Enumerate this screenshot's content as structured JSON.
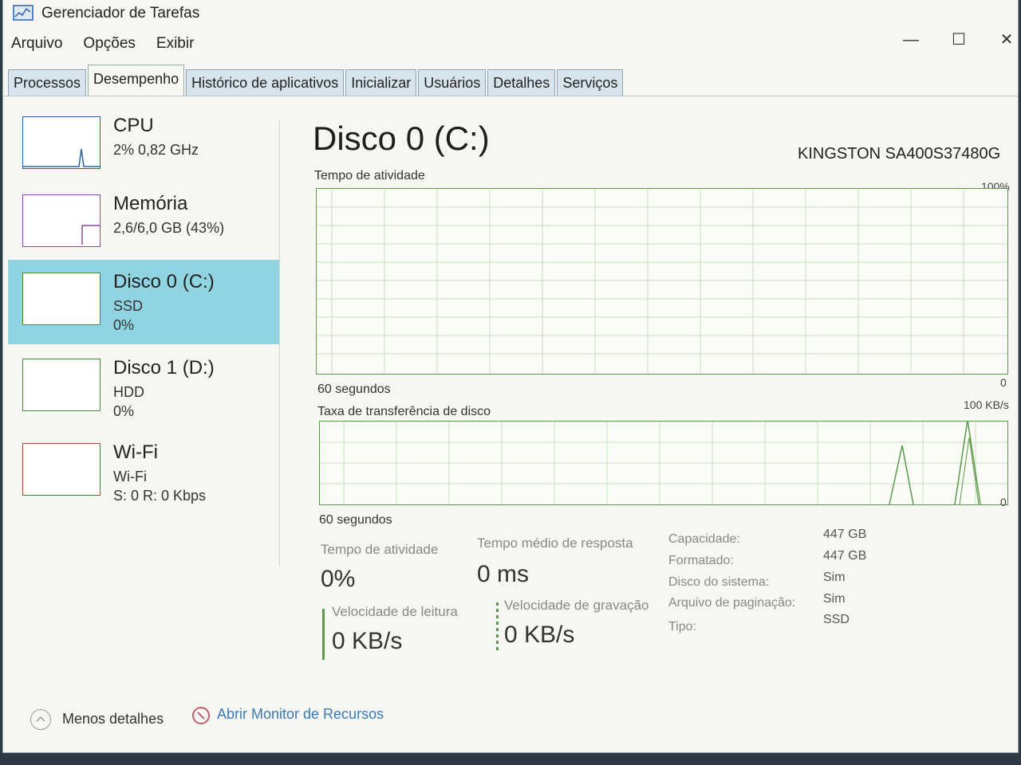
{
  "window": {
    "title": "Gerenciador de Tarefas",
    "controls": {
      "minimize": "—",
      "maximize": "☐",
      "close": "✕"
    }
  },
  "menu": [
    "Arquivo",
    "Opções",
    "Exibir"
  ],
  "tabs": [
    {
      "label": "Processos",
      "active": false
    },
    {
      "label": "Desempenho",
      "active": true
    },
    {
      "label": "Histórico de aplicativos",
      "active": false
    },
    {
      "label": "Inicializar",
      "active": false
    },
    {
      "label": "Usuários",
      "active": false
    },
    {
      "label": "Detalhes",
      "active": false
    },
    {
      "label": "Serviços",
      "active": false
    }
  ],
  "sidebar": {
    "items": [
      {
        "name": "CPU",
        "line1": "2% 0,82 GHz",
        "line2": ""
      },
      {
        "name": "Memória",
        "line1": "2,6/6,0 GB (43%)",
        "line2": ""
      },
      {
        "name": "Disco 0 (C:)",
        "line1": "SSD",
        "line2": "0%"
      },
      {
        "name": "Disco 1 (D:)",
        "line1": "HDD",
        "line2": "0%"
      },
      {
        "name": "Wi-Fi",
        "line1": "Wi-Fi",
        "line2": "S: 0 R: 0 Kbps"
      }
    ]
  },
  "main": {
    "title": "Disco 0 (C:)",
    "model": "KINGSTON SA400S37480G",
    "activity_graph": {
      "label": "Tempo de atividade",
      "max": "100%",
      "min": "0",
      "duration": "60 segundos"
    },
    "transfer_graph": {
      "label": "Taxa de transferência de disco",
      "max": "100 KB/s",
      "min": "0",
      "duration": "60 segundos"
    },
    "stats": {
      "active_time_label": "Tempo de atividade",
      "active_time_value": "0%",
      "response_label": "Tempo médio de resposta",
      "response_value": "0 ms",
      "read_label": "Velocidade de leitura",
      "read_value": "0 KB/s",
      "write_label": "Velocidade de gravação",
      "write_value": "0 KB/s"
    },
    "info": {
      "capacity_label": "Capacidade:",
      "capacity_value": "447 GB",
      "formatted_label": "Formatado:",
      "formatted_value": "447 GB",
      "system_disk_label": "Disco do sistema:",
      "system_disk_value": "Sim",
      "page_file_label": "Arquivo de paginação:",
      "page_file_value": "Sim",
      "type_label": "Tipo:",
      "type_value": "SSD"
    }
  },
  "footer": {
    "fewer_details": "Menos detalhes",
    "open_monitor": "Abrir Monitor de Recursos"
  },
  "colors": {
    "disk_graph": "#5a9a4a",
    "selected": "#8fd4e0",
    "cpu": "#2a62a8",
    "memory": "#8a4aa8",
    "wifi": "#a0522d"
  }
}
